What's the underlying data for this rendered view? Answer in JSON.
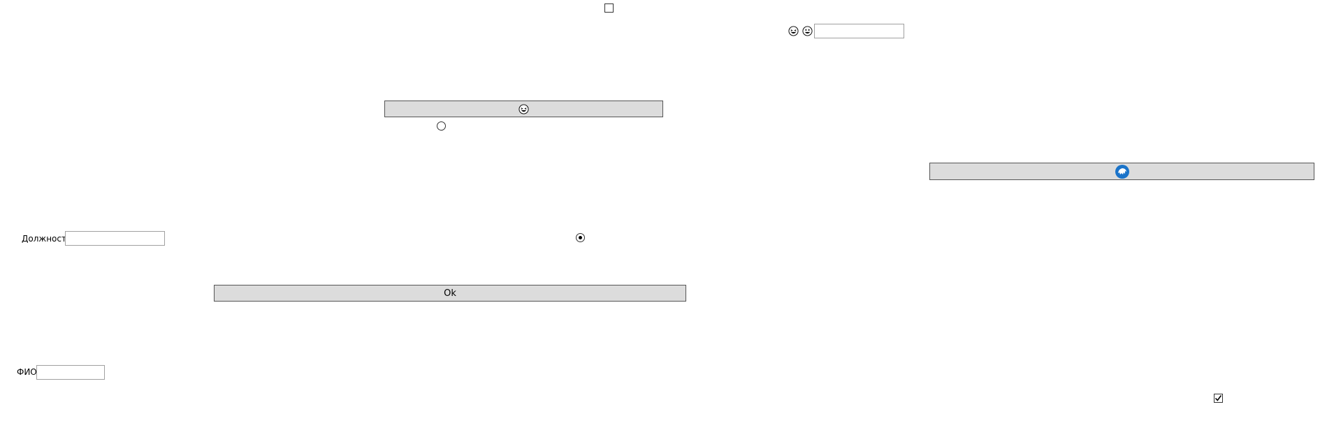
{
  "form": {
    "position_label": "Должность",
    "position_value": "",
    "fio_label": "ФИО",
    "fio_value": "",
    "ok_button_label": "Ok",
    "top_input_value": ""
  },
  "icons": {
    "top_emoji_1": "grinning-squint-face-icon",
    "top_emoji_2": "grinning-face-icon",
    "emoji_button_icon": "grinning-squint-face-icon",
    "blue_button_icon": "blue-circle-badge-icon"
  },
  "state": {
    "top_checkbox_checked": false,
    "bottom_checkbox_checked": true,
    "radio_1_selected": false,
    "radio_2_selected": true
  },
  "colors": {
    "button_bg": "#dcdcdc",
    "accent_blue": "#1a73c9"
  }
}
